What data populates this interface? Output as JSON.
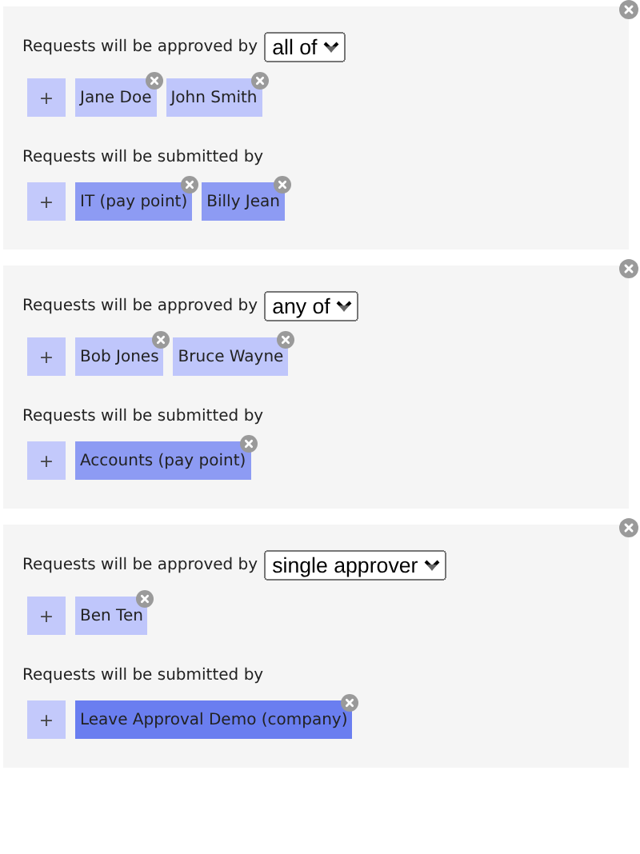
{
  "panels": [
    {
      "approved_label": "Requests will be approved by",
      "approval_mode": "all of",
      "add_approver": "+",
      "approvers": [
        {
          "name": "Jane Doe",
          "color": "#bfc6fb"
        },
        {
          "name": "John Smith",
          "color": "#bfc6fb"
        }
      ],
      "submitted_label": "Requests will be submitted by",
      "add_submitter": "+",
      "submitters": [
        {
          "name": "IT (pay point)",
          "color": "#8d9bf3"
        },
        {
          "name": "Billy Jean",
          "color": "#8d9bf3"
        }
      ]
    },
    {
      "approved_label": "Requests will be approved by",
      "approval_mode": "any of",
      "add_approver": "+",
      "approvers": [
        {
          "name": "Bob Jones",
          "color": "#bfc6fb"
        },
        {
          "name": "Bruce Wayne",
          "color": "#bfc6fb"
        }
      ],
      "submitted_label": "Requests will be submitted by",
      "add_submitter": "+",
      "submitters": [
        {
          "name": "Accounts (pay point)",
          "color": "#8d9bf3"
        }
      ]
    },
    {
      "approved_label": "Requests will be approved by",
      "approval_mode": "single approver",
      "add_approver": "+",
      "approvers": [
        {
          "name": "Ben Ten",
          "color": "#bfc6fb"
        }
      ],
      "submitted_label": "Requests will be submitted by",
      "add_submitter": "+",
      "submitters": [
        {
          "name": "Leave Approval Demo (company)",
          "color": "#6a7ef0"
        }
      ]
    }
  ]
}
